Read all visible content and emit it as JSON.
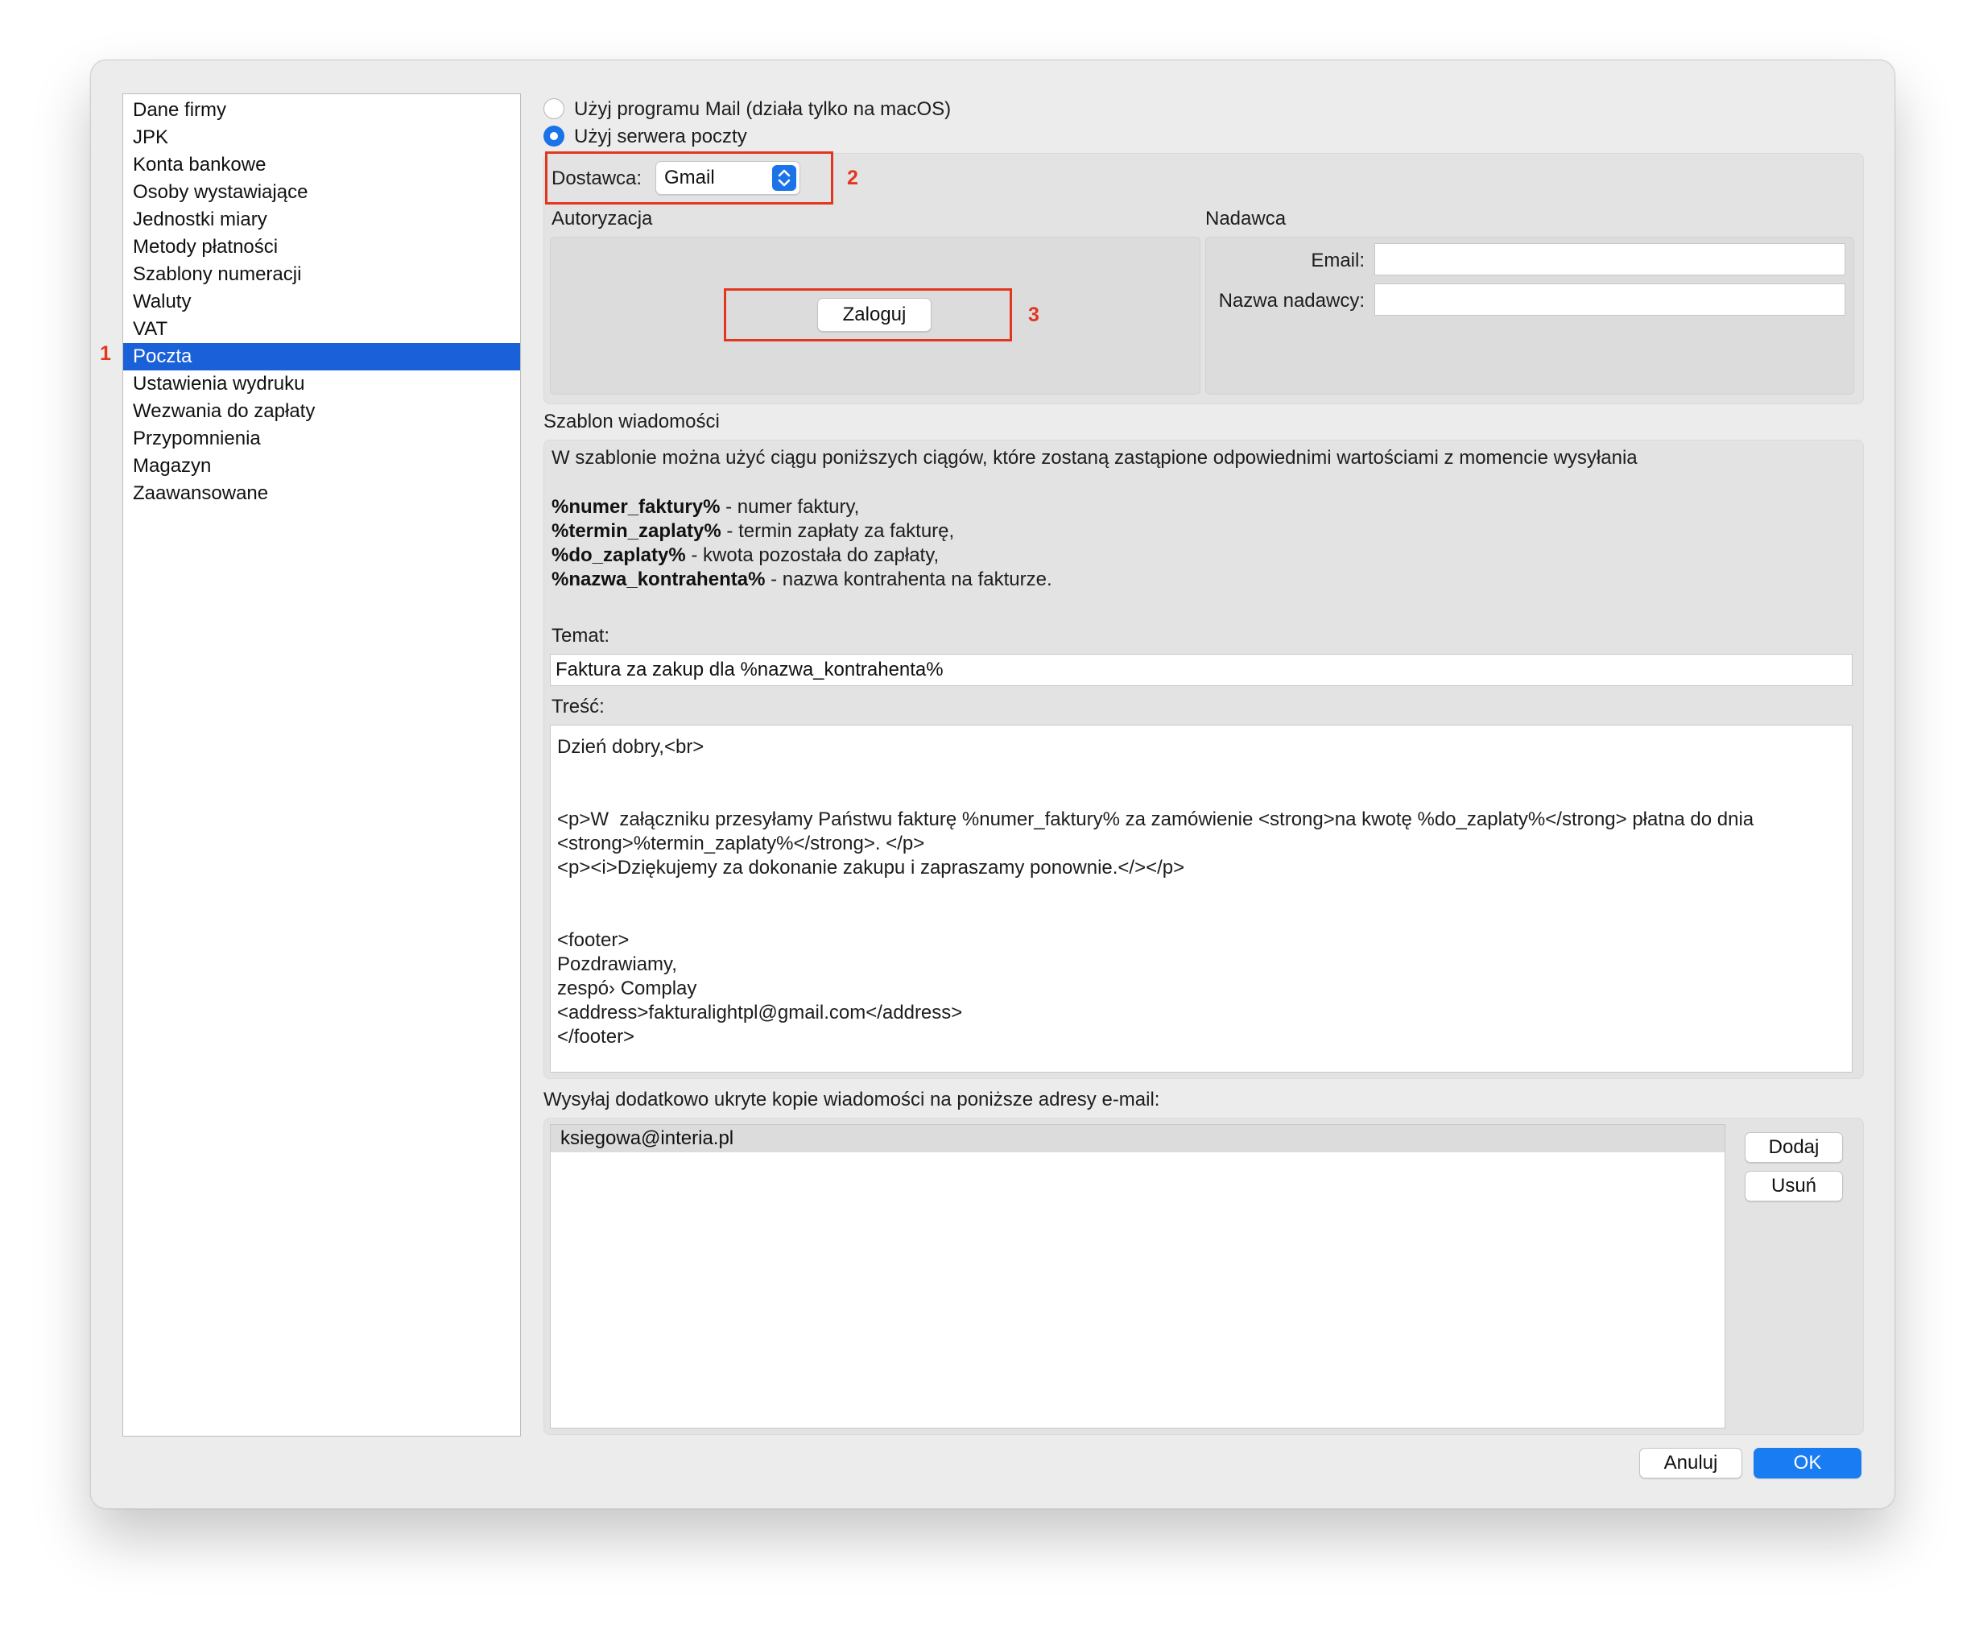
{
  "sidebar": {
    "items": [
      {
        "label": "Dane firmy"
      },
      {
        "label": "JPK"
      },
      {
        "label": "Konta bankowe"
      },
      {
        "label": "Osoby wystawiające"
      },
      {
        "label": "Jednostki miary"
      },
      {
        "label": "Metody płatności"
      },
      {
        "label": "Szablony numeracji"
      },
      {
        "label": "Waluty"
      },
      {
        "label": "VAT"
      },
      {
        "label": "Poczta"
      },
      {
        "label": "Ustawienia wydruku"
      },
      {
        "label": "Wezwania do zapłaty"
      },
      {
        "label": "Przypomnienia"
      },
      {
        "label": "Magazyn"
      },
      {
        "label": "Zaawansowane"
      }
    ],
    "selected": "Poczta"
  },
  "annotations": {
    "m1": "1",
    "m2": "2",
    "m3": "3",
    "color": "#e3361f"
  },
  "mail": {
    "option_mail_app": "Użyj programu Mail (działa tylko na macOS)",
    "option_server": "Użyj serwera poczty",
    "selected_option": "server",
    "provider_label": "Dostawca:",
    "provider_value": "Gmail",
    "auth_title": "Autoryzacja",
    "login_button": "Zaloguj",
    "sender_title": "Nadawca",
    "email_label": "Email:",
    "email_value": "",
    "sender_name_label": "Nazwa nadawcy:",
    "sender_name_value": ""
  },
  "template": {
    "title": "Szablon wiadomości",
    "intro": "W szablonie można użyć ciągu poniższych ciągów, które zostaną zastąpione odpowiednimi wartościami z momencie wysyłania",
    "vars": [
      {
        "name": "%numer_faktury%",
        "desc": " - numer faktury,"
      },
      {
        "name": "%termin_zaplaty%",
        "desc": " - termin zapłaty za fakturę,"
      },
      {
        "name": "%do_zaplaty%",
        "desc": " - kwota pozostała do zapłaty,"
      },
      {
        "name": "%nazwa_kontrahenta%",
        "desc": " - nazwa kontrahenta na fakturze."
      }
    ],
    "subject_label": "Temat:",
    "subject_value": "Faktura za zakup dla %nazwa_kontrahenta%",
    "body_label": "Treść:",
    "body_value": "Dzień dobry,<br>\n\n\n<p>W  załączniku przesyłamy Państwu fakturę %numer_faktury% za zamówienie <strong>na kwotę %do_zaplaty%</strong> płatna do dnia\n<strong>%termin_zaplaty%</strong>. </p>\n<p><i>Dziękujemy za dokonanie zakupu i zapraszamy ponownie.</></p>\n\n\n<footer>\nPozdrawiamy,\nzespó› Complay\n<address>fakturalightpl@gmail.com</address>\n</footer>"
  },
  "bcc": {
    "title": "Wysyłaj dodatkowo ukryte kopie wiadomości na poniższe adresy e-mail:",
    "addresses": [
      "ksiegowa@interia.pl"
    ],
    "add_button": "Dodaj",
    "remove_button": "Usuń"
  },
  "footer": {
    "cancel_button": "Anuluj",
    "ok_button": "OK"
  },
  "icons": {
    "select_arrows": "chevron-up-down-icon"
  },
  "colors": {
    "accent": "#1a60d9",
    "primary_button": "#1a7cf2"
  }
}
